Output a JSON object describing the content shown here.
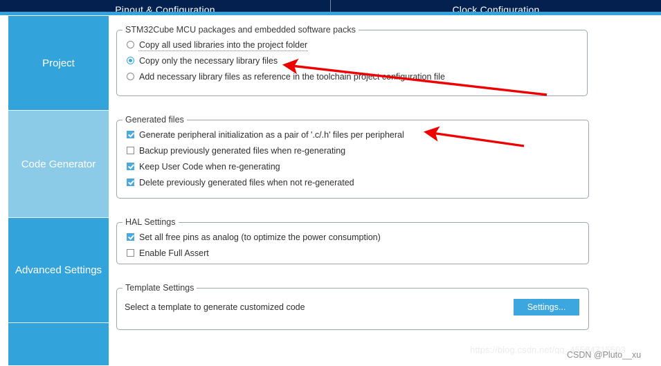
{
  "tabbar": {
    "tabs": [
      {
        "label": "Pinout & Configuration"
      },
      {
        "label": "Clock Configuration"
      }
    ]
  },
  "sidebar": {
    "items": [
      {
        "label": "Project"
      },
      {
        "label": "Code Generator"
      },
      {
        "label": "Advanced Settings"
      },
      {
        "label": ""
      }
    ]
  },
  "groups": {
    "packages": {
      "legend": "STM32Cube MCU packages and embedded software packs",
      "options": [
        {
          "label": "Copy all used libraries into the project folder",
          "selected": false,
          "focused": true
        },
        {
          "label": "Copy only the necessary library files",
          "selected": true,
          "focused": false
        },
        {
          "label": "Add necessary library files as reference in the toolchain project configuration file",
          "selected": false,
          "focused": false
        }
      ]
    },
    "generated": {
      "legend": "Generated files",
      "options": [
        {
          "label": "Generate peripheral initialization as a pair of '.c/.h' files per peripheral",
          "checked": true
        },
        {
          "label": "Backup previously generated files when re-generating",
          "checked": false
        },
        {
          "label": "Keep User Code when re-generating",
          "checked": true
        },
        {
          "label": "Delete previously generated files when not re-generated",
          "checked": true
        }
      ]
    },
    "hal": {
      "legend": "HAL Settings",
      "options": [
        {
          "label": "Set all free pins as analog (to optimize the power consumption)",
          "checked": true
        },
        {
          "label": "Enable Full Assert",
          "checked": false
        }
      ]
    },
    "template": {
      "legend": "Template Settings",
      "description": "Select a template to generate customized code",
      "button_label": "Settings..."
    }
  },
  "annotations": {
    "arrow_1_name": "red-arrow-to-copy-only-necessary",
    "arrow_2_name": "red-arrow-to-generate-peripheral-init"
  },
  "watermarks": {
    "url": "https://blog.csdn.net/qq_45584715503",
    "user": "CSDN @Pluto__xu"
  },
  "colors": {
    "tabbar_bg": "#04204f",
    "accent": "#33a3dc",
    "accent_light": "#8bcbe8",
    "arrow_red": "#ee0000"
  }
}
